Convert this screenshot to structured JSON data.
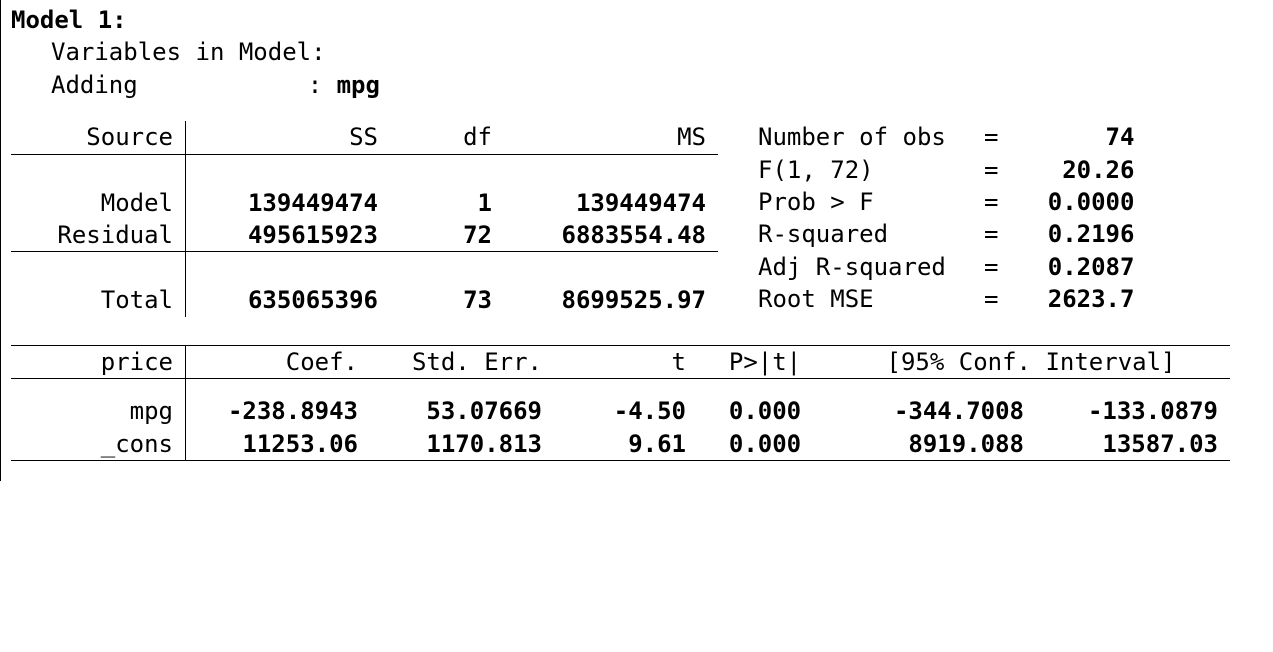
{
  "header": {
    "model_label": "Model 1:",
    "vars_in_model_label": "Variables in Model:",
    "adding_label": "Adding",
    "colon": ":",
    "added_var": "mpg"
  },
  "anova": {
    "cols": {
      "source": "Source",
      "ss": "SS",
      "df": "df",
      "ms": "MS"
    },
    "rows": {
      "model": {
        "label": "Model",
        "ss": "139449474",
        "df": "1",
        "ms": "139449474"
      },
      "residual": {
        "label": "Residual",
        "ss": "495615923",
        "df": "72",
        "ms": "6883554.48"
      },
      "total": {
        "label": "Total",
        "ss": "635065396",
        "df": "73",
        "ms": "8699525.97"
      }
    }
  },
  "stats": {
    "nobs": {
      "label": "Number of obs",
      "eq": "=",
      "value": "74"
    },
    "f": {
      "label": "F(1, 72)",
      "eq": "=",
      "value": "20.26"
    },
    "probf": {
      "label": "Prob > F",
      "eq": "=",
      "value": "0.0000"
    },
    "r2": {
      "label": "R-squared",
      "eq": "=",
      "value": "0.2196"
    },
    "adjr2": {
      "label": "Adj R-squared",
      "eq": "=",
      "value": "0.2087"
    },
    "rmse": {
      "label": "Root MSE",
      "eq": "=",
      "value": "2623.7"
    }
  },
  "coef": {
    "depvar": "price",
    "cols": {
      "coef": "Coef.",
      "se": "Std. Err.",
      "t": "t",
      "p": "P>|t|",
      "ci": "[95% Conf. Interval]"
    },
    "rows": {
      "mpg": {
        "label": "mpg",
        "coef": "-238.8943",
        "se": "53.07669",
        "t": "-4.50",
        "p": "0.000",
        "lo": "-344.7008",
        "hi": "-133.0879"
      },
      "cons": {
        "label": "_cons",
        "coef": "11253.06",
        "se": "1170.813",
        "t": "9.61",
        "p": "0.000",
        "lo": "8919.088",
        "hi": "13587.03"
      }
    }
  }
}
